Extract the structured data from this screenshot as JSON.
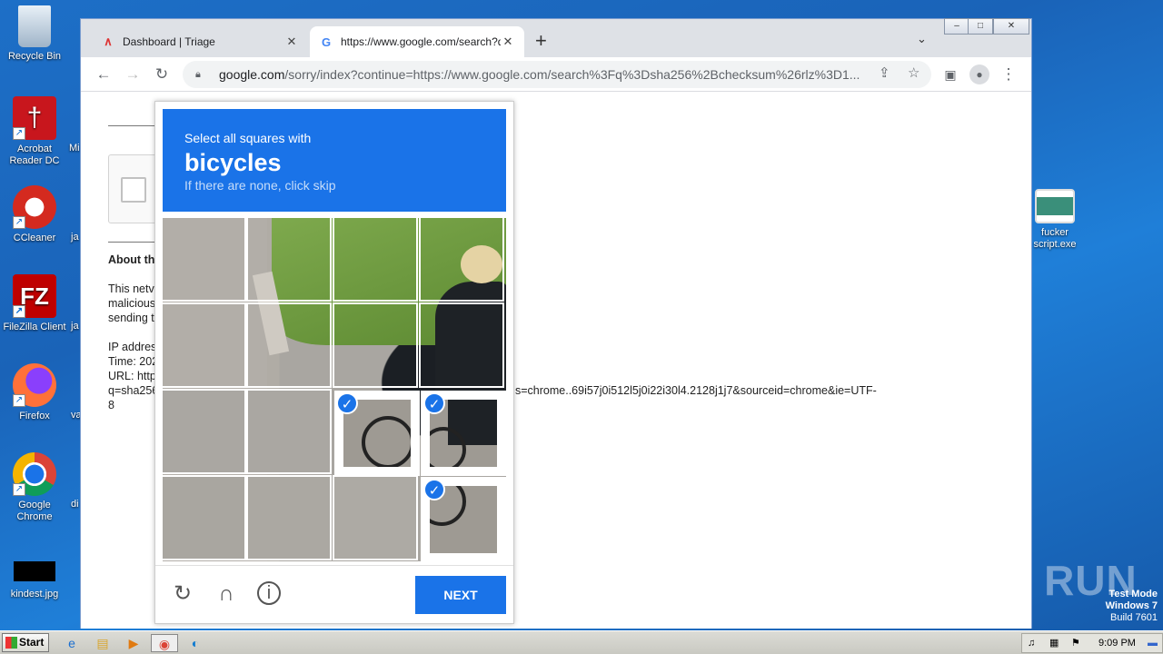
{
  "desktop": {
    "icons": [
      {
        "label": "Recycle Bin",
        "icon": "recycle-bin-icon"
      },
      {
        "label": "Acrobat Reader DC",
        "icon": "acrobat-icon"
      },
      {
        "label": "CCleaner",
        "icon": "ccleaner-icon"
      },
      {
        "label": "FileZilla Client",
        "icon": "filezilla-icon"
      },
      {
        "label": "Firefox",
        "icon": "firefox-icon"
      },
      {
        "label": "Google Chrome",
        "icon": "chrome-icon"
      },
      {
        "label": "kindest.jpg",
        "icon": "image-file-icon"
      },
      {
        "label": "fucker script.exe",
        "icon": "exe-file-icon"
      }
    ],
    "partial_labels": [
      "Mi",
      "ja",
      "ja",
      "va",
      "di"
    ],
    "watermark": {
      "line1": "Test Mode",
      "line2": "Windows 7",
      "line3": "Build 7601",
      "brand": "ANY RUN"
    }
  },
  "browser": {
    "tabs": [
      {
        "title": "Dashboard | Triage",
        "active": false
      },
      {
        "title": "https://www.google.com/search?q=",
        "active": true
      }
    ],
    "address": {
      "host": "google.com",
      "path": "/sorry/index?continue=https://www.google.com/search%3Fq%3Dsha256%2Bchecksum%26rlz%3D1..."
    }
  },
  "page": {
    "about_heading": "About th",
    "p1": "This netv",
    "p2": "malicious",
    "p3": "sending t",
    "ip": "IP addres",
    "time": "Time: 202",
    "url": "URL: http",
    "q": "q=sha256",
    "url_tail": "s=chrome..69i57j0i512l5j0i22i30l4.2128j1j7&sourceid=chrome&ie=UTF-",
    "url_tail2": "8"
  },
  "captcha": {
    "line1": "Select all squares with",
    "target": "bicycles",
    "line3": "If there are none, click skip",
    "selected_tiles": [
      7,
      11,
      15
    ],
    "next_label": "NEXT"
  },
  "taskbar": {
    "start_label": "Start",
    "clock": "9:09 PM"
  }
}
